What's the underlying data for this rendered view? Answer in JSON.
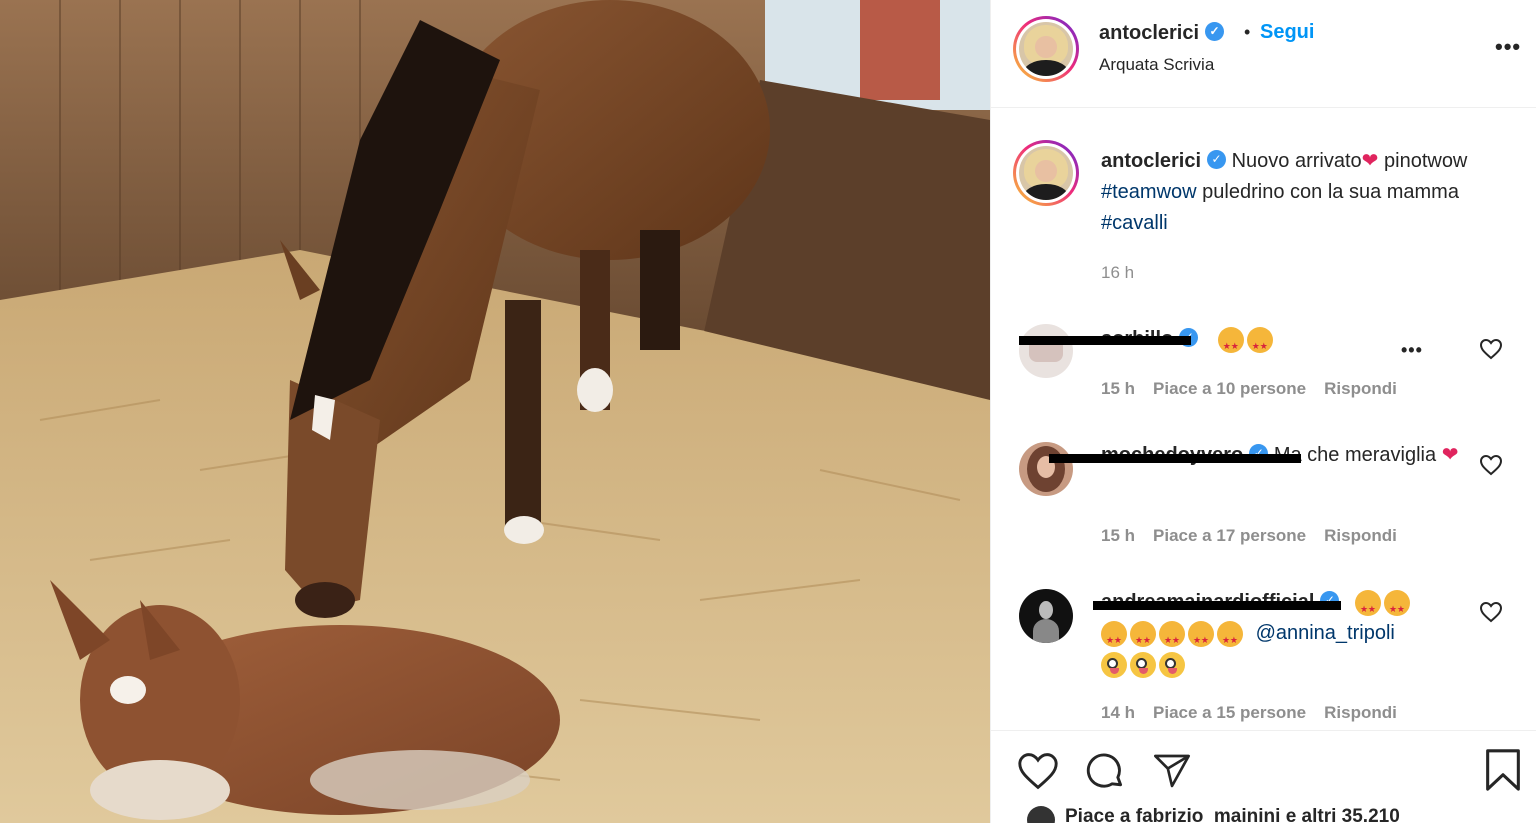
{
  "post": {
    "username": "antoclerici",
    "verified_icon": "verified-badge-icon",
    "separator": "•",
    "follow_label": "Segui",
    "location": "Arquata Scrivia",
    "more_icon": "more-options-icon"
  },
  "caption": {
    "username": "antoclerici",
    "text_1": "Nuovo arrivato",
    "heart": "❤",
    "text_2": "pinotwow",
    "hashtag_1": "#teamwow",
    "text_3": "puledrino con la sua mamma",
    "hashtag_2": "#cavalli",
    "time": "16 h"
  },
  "comments": [
    {
      "username": "sorbillo",
      "emoji_count": 2,
      "text": "",
      "time": "15 h",
      "likes": "Piace a 10 persone",
      "reply": "Rispondi"
    },
    {
      "username": "mochedoyvero",
      "text": "Ma che meraviglia",
      "heart": "❤",
      "time": "15 h",
      "likes": "Piace a 17 persone",
      "reply": "Rispondi"
    },
    {
      "username": "andreamainardiofficial",
      "mention": "@annina_tripoli",
      "time": "14 h",
      "likes": "Piace a 15 persone",
      "reply": "Rispondi"
    }
  ],
  "footer": {
    "likes_text": "Piace a fabrizio_mainini e altri 35.210"
  },
  "colors": {
    "link_blue": "#0095f6",
    "hashtag_blue": "#00376b",
    "muted_gray": "#8e8e8e",
    "verified_blue": "#3897f0"
  }
}
